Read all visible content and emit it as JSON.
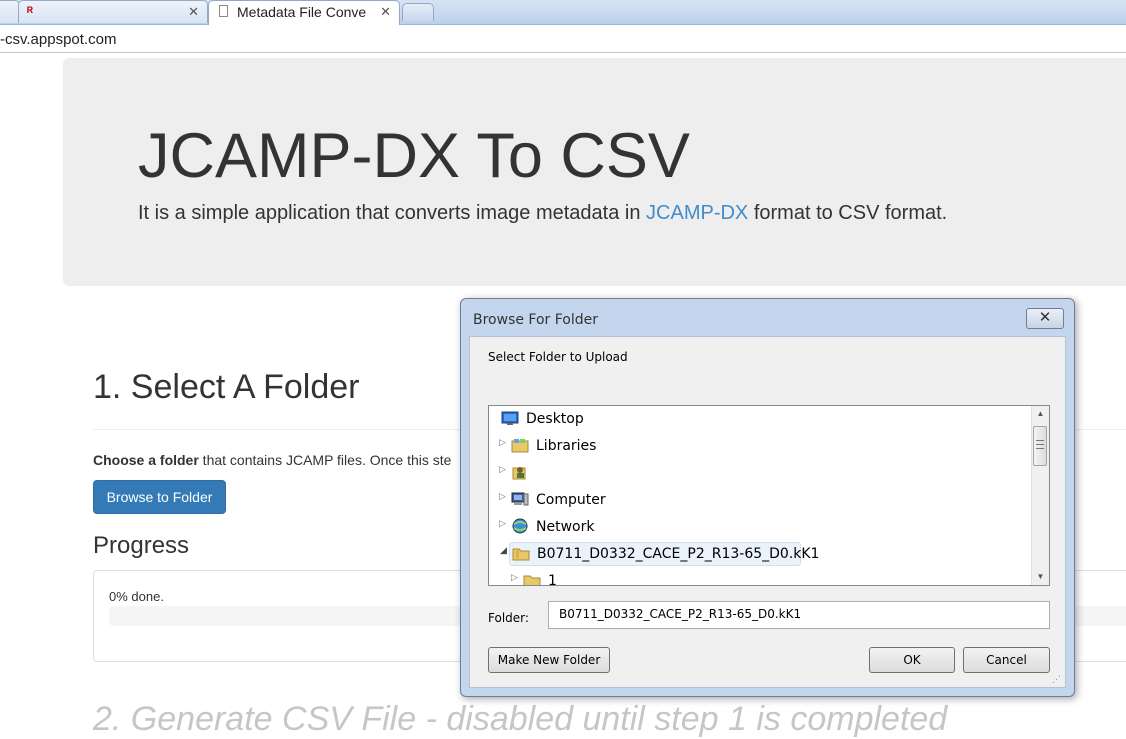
{
  "browser": {
    "tabs": [
      {
        "label": ""
      },
      {
        "label": ""
      },
      {
        "label": "Metadata File Conve"
      }
    ],
    "url": "-csv.appspot.com"
  },
  "hero": {
    "title": "JCAMP-DX To CSV",
    "desc_pre": "It is a simple application that converts image metadata in ",
    "desc_link": "JCAMP-DX",
    "desc_post": " format to CSV format."
  },
  "step1": {
    "heading": "1. Select A Folder",
    "choose_bold": "Choose a folder",
    "choose_rest": " that contains JCAMP files. Once this ste",
    "browse_button": "Browse to Folder",
    "progress_heading": "Progress",
    "progress_text": "0% done.",
    "progress_value": 0
  },
  "step2": {
    "heading": "2. Generate CSV File - disabled until step 1 is completed"
  },
  "dialog": {
    "title": "Browse For Folder",
    "close_symbol": "✕",
    "instruction": "Select Folder to Upload",
    "tree": [
      {
        "label": "Desktop",
        "icon": "desktop-icon"
      },
      {
        "label": "Libraries",
        "icon": "libraries-icon"
      },
      {
        "label": "",
        "icon": "user-folder-icon"
      },
      {
        "label": "Computer",
        "icon": "computer-icon"
      },
      {
        "label": "Network",
        "icon": "network-icon"
      },
      {
        "label": "B0711_D0332_CACE_P2_R13-65_D0.kK1",
        "icon": "folder-icon"
      },
      {
        "label": "1",
        "icon": "folder-icon"
      }
    ],
    "folder_label": "Folder:",
    "folder_value": "B0711_D0332_CACE_P2_R13-65_D0.kK1",
    "make_new_folder": "Make New Folder",
    "ok": "OK",
    "cancel": "Cancel"
  }
}
